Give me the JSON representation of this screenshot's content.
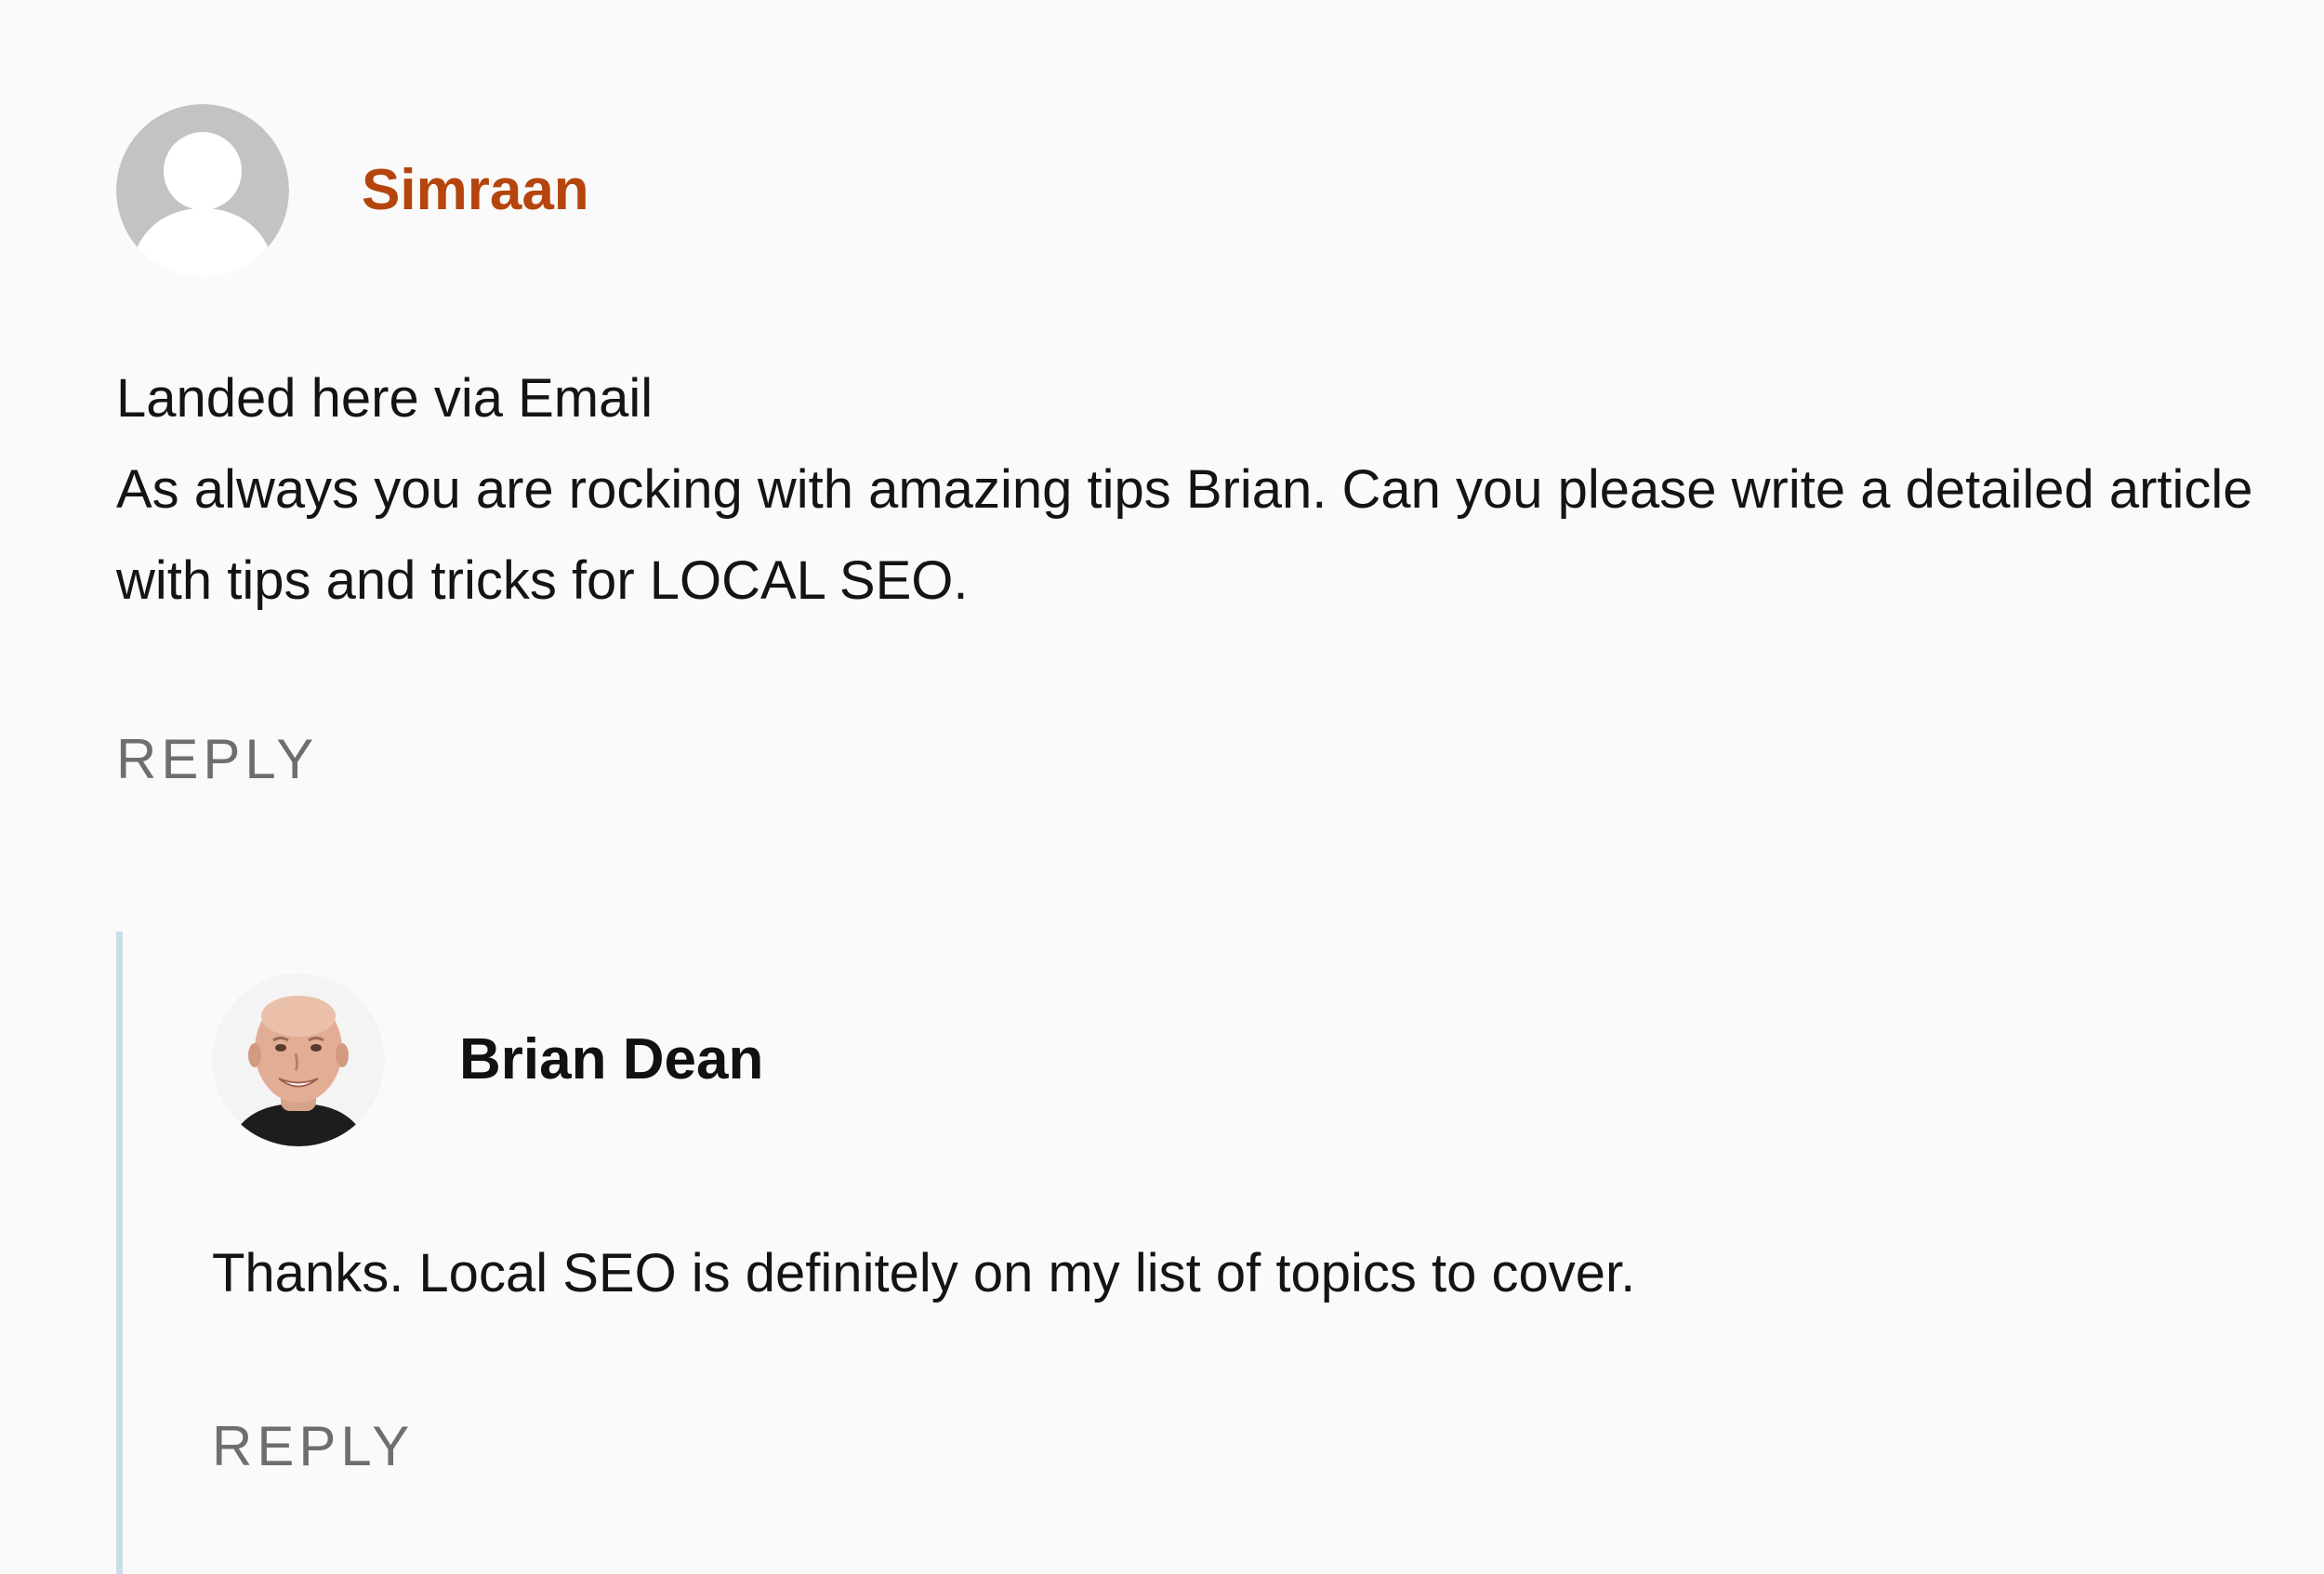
{
  "comments": [
    {
      "author": "Simraan",
      "author_color": "#b5450d",
      "avatar_icon": "default-user-avatar-icon",
      "body": [
        "Landed here via Email",
        "As always you are rocking with amazing tips Brian. Can you please write a detailed article with tips and tricks for LOCAL SEO."
      ],
      "reply_label": "REPLY"
    },
    {
      "author": "Brian Dean",
      "author_color": "#111111",
      "avatar_icon": "profile-photo-avatar-icon",
      "body": [
        "Thanks. Local SEO is definitely on my list of topics to cover."
      ],
      "reply_label": "REPLY"
    }
  ],
  "thread_line_color": "#c9dfe6"
}
